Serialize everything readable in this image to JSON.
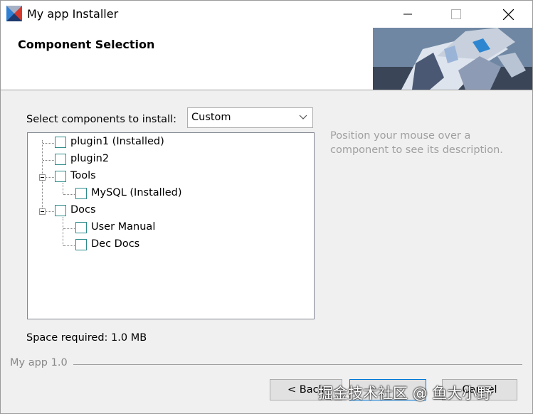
{
  "window": {
    "title": "My app Installer"
  },
  "header": {
    "title": "Component Selection"
  },
  "select_label": "Select components to install:",
  "dropdown": {
    "value": "Custom"
  },
  "tree": [
    {
      "label": "plugin1 (Installed)"
    },
    {
      "label": "plugin2"
    },
    {
      "label": "Tools"
    },
    {
      "label": "MySQL (Installed)"
    },
    {
      "label": "Docs"
    },
    {
      "label": "User Manual"
    },
    {
      "label": "Dec Docs"
    }
  ],
  "description": "Position your mouse over a component to see its description.",
  "space_required": "Space required: 1.0 MB",
  "footer": {
    "brand": "My app 1.0"
  },
  "buttons": {
    "back": "< Back",
    "next": "",
    "cancel": "Cancel"
  },
  "watermark": "掘金技术社区 @ 鱼大小野",
  "colors": {
    "accent": "#0078d7",
    "checkbox_border": "#2e8b8b"
  }
}
